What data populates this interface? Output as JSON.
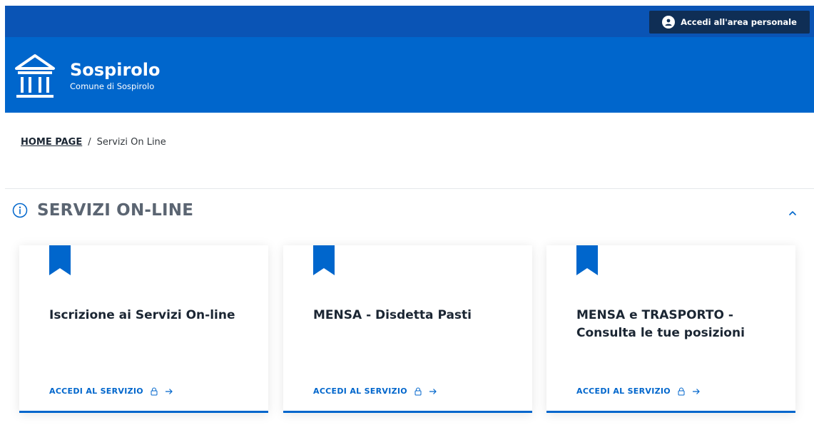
{
  "topbar": {
    "login_label": "Accedi all'area personale"
  },
  "header": {
    "name": "Sospirolo",
    "subtitle": "Comune di Sospirolo"
  },
  "breadcrumb": {
    "home": "HOME PAGE",
    "separator": "/",
    "current": "Servizi On Line"
  },
  "section": {
    "title": "SERVIZI ON-LINE"
  },
  "cards": [
    {
      "title": "Iscrizione ai Servizi On-line",
      "link": "ACCEDI AL SERVIZIO"
    },
    {
      "title": "MENSA - Disdetta Pasti",
      "link": "ACCEDI AL SERVIZIO"
    },
    {
      "title": "MENSA e TRASPORTO - Consulta le tue posizioni",
      "link": "ACCEDI AL SERVIZIO"
    }
  ],
  "icons": {
    "login": "user-circle-icon",
    "logo": "town-hall-icon",
    "section": "info-icon",
    "collapse": "chevron-up-icon",
    "card_ribbon": "bookmark-icon",
    "card_lock": "lock-icon",
    "card_arrow": "arrow-right-icon"
  },
  "colors": {
    "primary": "#0066cc",
    "topbar": "#0a54b5",
    "button_dark": "#0f2e55",
    "text": "#1b2633"
  }
}
